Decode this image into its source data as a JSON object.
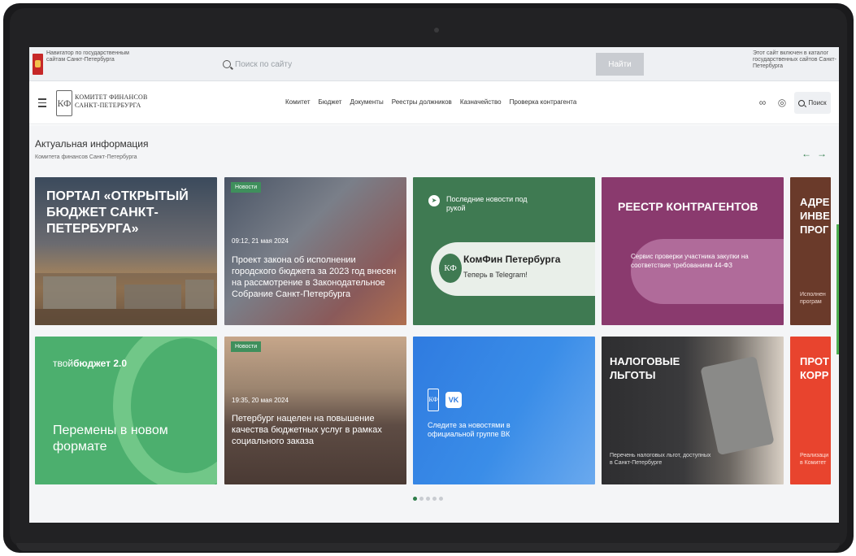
{
  "gov_bar": {
    "navigator": "Навигатор по государственным сайтам Санкт-Петербурга",
    "search_placeholder": "Поиск по сайту",
    "search_button": "Найти",
    "catalog_note": "Этот сайт включен в каталог государственных сайтов Санкт-Петербурга"
  },
  "header": {
    "logo_line1": "КОМИТЕТ ФИНАНСОВ",
    "logo_line2": "САНКТ-ПЕТЕРБУРГА",
    "logo_mark": "КФ",
    "nav": [
      "Комитет",
      "Бюджет",
      "Документы",
      "Реестры должников",
      "Казначейство",
      "Проверка контрагента"
    ],
    "search_label": "Поиск"
  },
  "section": {
    "title": "Актуальная информация",
    "subtitle": "Комитета финансов Санкт-Петербурга",
    "arrow_prev": "←",
    "arrow_next": "→"
  },
  "cards": [
    {
      "text": "ПОРТАЛ «ОТКРЫТЫЙ БЮДЖЕТ САНКТ-ПЕТЕРБУРГА»"
    },
    {
      "badge": "Новости",
      "time": "09:12, 21 мая 2024",
      "text": "Проект закона об исполнении городского бюджета за 2023 год внесен на рассмотрение в Законодательное Собрание Санкт-Петербурга"
    },
    {
      "header": "Последние новости под рукой",
      "channel": "КомФин Петербурга",
      "channel_sub": "Теперь в Telegram!"
    },
    {
      "title": "РЕЕСТР КОНТРАГЕНТОВ",
      "text": "Сервис проверки участника закупки на соответствие требованиям 44-ФЗ"
    },
    {
      "title": "АДРЕ ИНВЕ ПРОГ",
      "text": "Исполнен програм"
    },
    {
      "brand_prefix": "твой",
      "brand": "бюджет 2.0",
      "text": "Перемены в новом формате"
    },
    {
      "badge": "Новости",
      "time": "19:35, 20 мая 2024",
      "text": "Петербург нацелен на повышение качества бюджетных услуг в рамках социального заказа"
    },
    {
      "vk": "VK",
      "text": "Следите за новостями в официальной группе ВК"
    },
    {
      "title": "НАЛОГОВЫЕ ЛЬГОТЫ",
      "text": "Перечень налоговых льгот, доступных в Санкт-Петербурге"
    },
    {
      "title": "ПРОТ КОРР",
      "text": "Реализаци в Комитет"
    }
  ],
  "pagination": {
    "count": 5,
    "active": 1
  },
  "colors": {
    "accent": "#2e7d4a",
    "search_btn": "#c9ccd1"
  }
}
